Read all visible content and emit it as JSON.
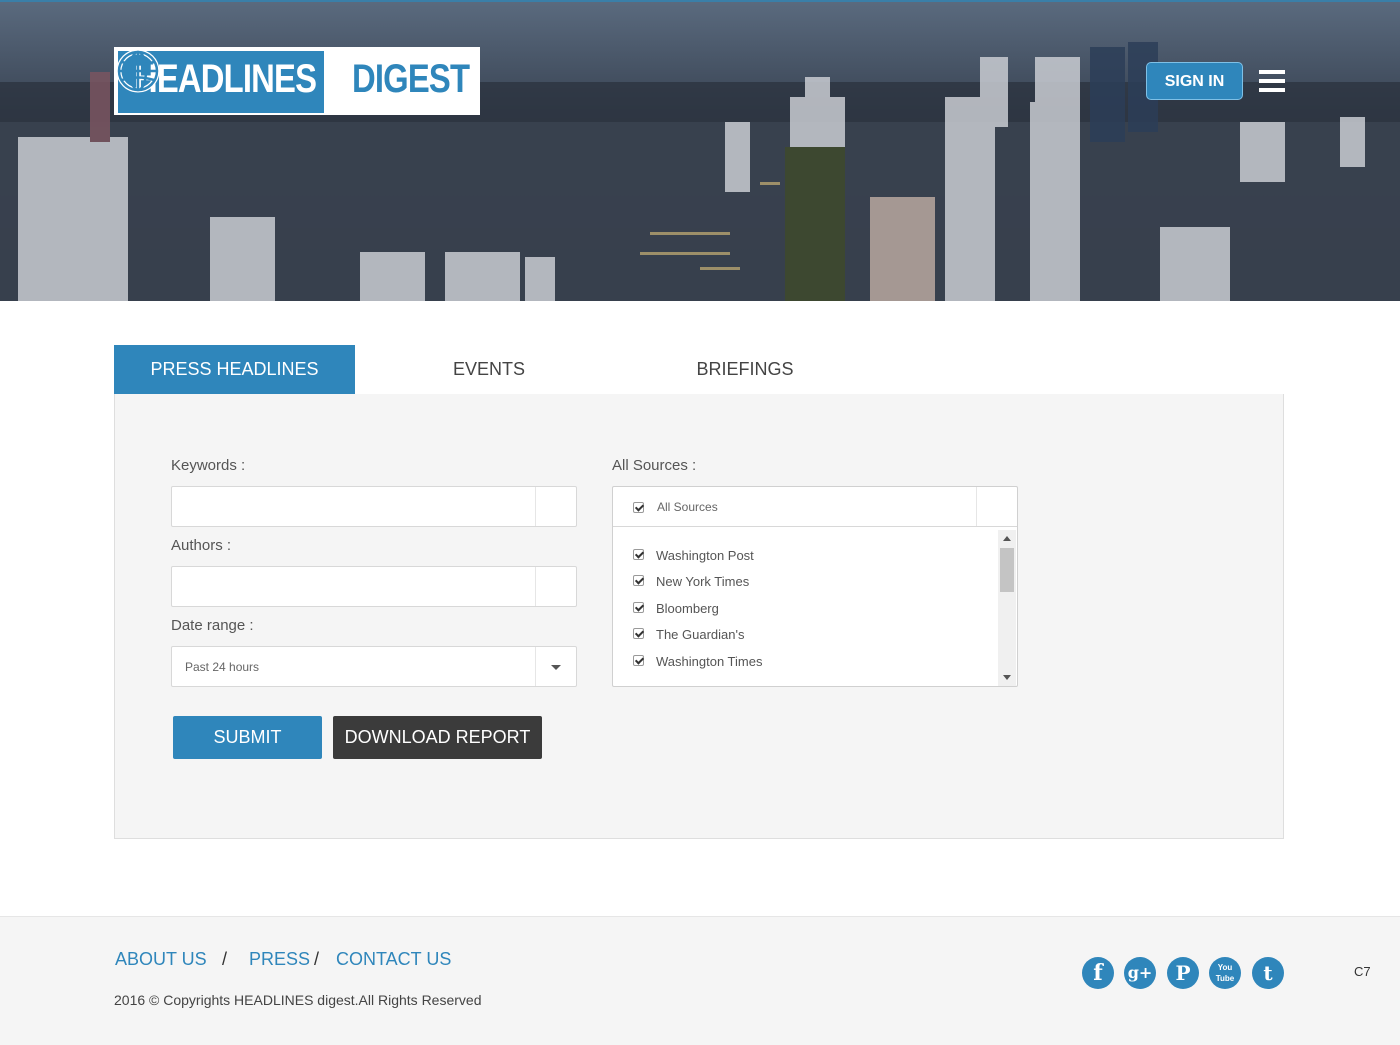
{
  "header": {
    "logo_left": "HEADLINES",
    "logo_right": "DIGEST",
    "signin_label": "SIGN IN"
  },
  "tabs": [
    {
      "label": "PRESS HEADLINES",
      "active": true
    },
    {
      "label": "EVENTS",
      "active": false
    },
    {
      "label": "BRIEFINGS",
      "active": false
    }
  ],
  "form": {
    "keywords_label": "Keywords :",
    "keywords_value": "",
    "authors_label": "Authors :",
    "authors_value": "",
    "date_range_label": "Date range :",
    "date_range_value": "Past 24 hours",
    "submit_label": "SUBMIT",
    "download_label": "DOWNLOAD REPORT"
  },
  "sources": {
    "label": "All Sources :",
    "all_label": "All Sources",
    "all_checked": true,
    "items": [
      {
        "label": "Washington Post",
        "checked": true
      },
      {
        "label": "New York Times",
        "checked": true
      },
      {
        "label": "Bloomberg",
        "checked": true
      },
      {
        "label": "The Guardian's",
        "checked": true
      },
      {
        "label": "Washington Times",
        "checked": true
      }
    ]
  },
  "footer": {
    "links": [
      "ABOUT US",
      "PRESS",
      "CONTACT US"
    ],
    "separator": "/",
    "copyright": "2016 © Copyrights HEADLINES digest.All Rights Reserved",
    "social": [
      {
        "name": "facebook-icon",
        "glyph": "f"
      },
      {
        "name": "google-plus-icon",
        "glyph": "g+"
      },
      {
        "name": "pinterest-icon",
        "glyph": "P"
      },
      {
        "name": "youtube-icon",
        "glyph": "You Tube"
      },
      {
        "name": "twitter-icon",
        "glyph": "t"
      }
    ],
    "corner_code": "C7"
  },
  "colors": {
    "accent": "#2f86bb",
    "dark_button": "#3b3b3b",
    "panel_bg": "#f5f5f5"
  }
}
